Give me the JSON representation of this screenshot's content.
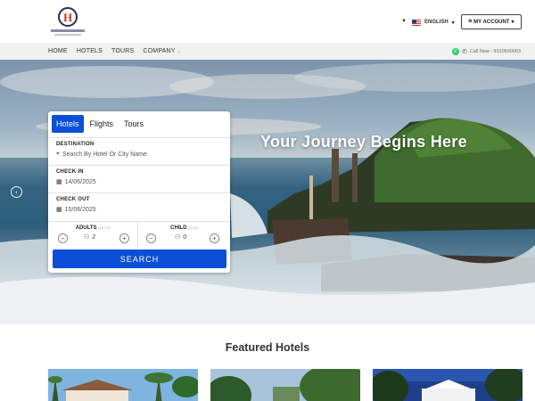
{
  "header": {
    "language": "ENGLISH",
    "account": "MY ACCOUNT"
  },
  "nav": {
    "links": [
      "HOME",
      "HOTELS",
      "TOURS",
      "COMPANY"
    ],
    "contact": "Call Now : 9310500003"
  },
  "hero": {
    "title": "Your Journey Begins Here"
  },
  "search": {
    "tabs": [
      "Hotels",
      "Flights",
      "Tours"
    ],
    "active_tab": "Hotels",
    "destination_label": "DESTINATION",
    "destination_placeholder": "Search By Hotel Or City Name",
    "checkin_label": "CHECK IN",
    "checkin_value": "14/06/2025",
    "checkout_label": "CHECK OUT",
    "checkout_value": "15/06/2025",
    "adults_label": "ADULTS",
    "adults_hint": "(12+ Y)",
    "adults_value": "2",
    "child_label": "CHILD",
    "child_hint": "(2-12)",
    "child_value": "0",
    "button": "SEARCH"
  },
  "featured": {
    "title": "Featured Hotels"
  },
  "icons": {
    "flag": "us-flag-icon",
    "whatsapp": "whatsapp-icon",
    "phone": "phone-icon",
    "location": "map-pin-icon",
    "calendar": "calendar-icon",
    "person": "person-icon"
  },
  "colors": {
    "primary": "#0b4fd6",
    "nav_bg": "#f1f1f1"
  }
}
